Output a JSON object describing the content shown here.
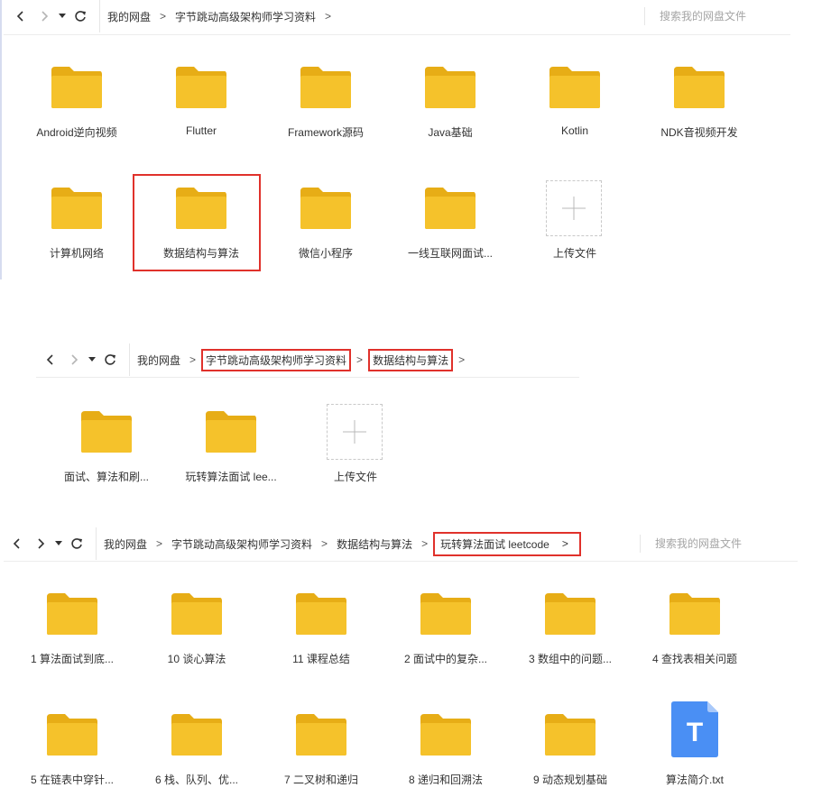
{
  "colors": {
    "folder": "#f5c22b",
    "folder_tab": "#e7ad16",
    "highlight": "#e0312b",
    "file_blue": "#4a8ff4"
  },
  "icons": {
    "back": "chevron-left-icon",
    "forward": "chevron-right-icon",
    "dropdown": "caret-down-icon",
    "refresh": "refresh-icon",
    "folder": "folder-icon",
    "upload": "plus-icon",
    "text_file": "text-file-icon"
  },
  "panel1": {
    "breadcrumb": [
      "我的网盘",
      "字节跳动高级架构师学习资料"
    ],
    "search_placeholder": "搜索我的网盘文件",
    "items": [
      {
        "type": "folder",
        "label": "Android逆向视频"
      },
      {
        "type": "folder",
        "label": "Flutter"
      },
      {
        "type": "folder",
        "label": "Framework源码"
      },
      {
        "type": "folder",
        "label": "Java基础"
      },
      {
        "type": "folder",
        "label": "Kotlin"
      },
      {
        "type": "folder",
        "label": "NDK音视频开发"
      },
      {
        "type": "folder",
        "label": "计算机网络"
      },
      {
        "type": "folder",
        "label": "数据结构与算法",
        "highlighted": true
      },
      {
        "type": "folder",
        "label": "微信小程序"
      },
      {
        "type": "folder",
        "label": "一线互联网面试..."
      },
      {
        "type": "upload",
        "label": "上传文件"
      }
    ]
  },
  "panel2": {
    "breadcrumb": [
      "我的网盘",
      "字节跳动高级架构师学习资料",
      "数据结构与算法"
    ],
    "items": [
      {
        "type": "folder",
        "label": "面试、算法和刷..."
      },
      {
        "type": "folder",
        "label": "玩转算法面试 lee..."
      },
      {
        "type": "upload",
        "label": "上传文件"
      }
    ]
  },
  "panel3": {
    "breadcrumb": [
      "我的网盘",
      "字节跳动高级架构师学习资料",
      "数据结构与算法",
      "玩转算法面试 leetcode"
    ],
    "search_placeholder": "搜索我的网盘文件",
    "items": [
      {
        "type": "folder",
        "label": "1 算法面试到底..."
      },
      {
        "type": "folder",
        "label": "10 谈心算法"
      },
      {
        "type": "folder",
        "label": "11 课程总结"
      },
      {
        "type": "folder",
        "label": "2 面试中的复杂..."
      },
      {
        "type": "folder",
        "label": "3 数组中的问题..."
      },
      {
        "type": "folder",
        "label": "4 查找表相关问题"
      },
      {
        "type": "folder",
        "label": "5 在链表中穿针..."
      },
      {
        "type": "folder",
        "label": "6 栈、队列、优..."
      },
      {
        "type": "folder",
        "label": "7 二叉树和递归"
      },
      {
        "type": "folder",
        "label": "8 递归和回溯法"
      },
      {
        "type": "folder",
        "label": "9 动态规划基础"
      },
      {
        "type": "file",
        "label": "算法简介.txt",
        "glyph": "T"
      }
    ]
  }
}
